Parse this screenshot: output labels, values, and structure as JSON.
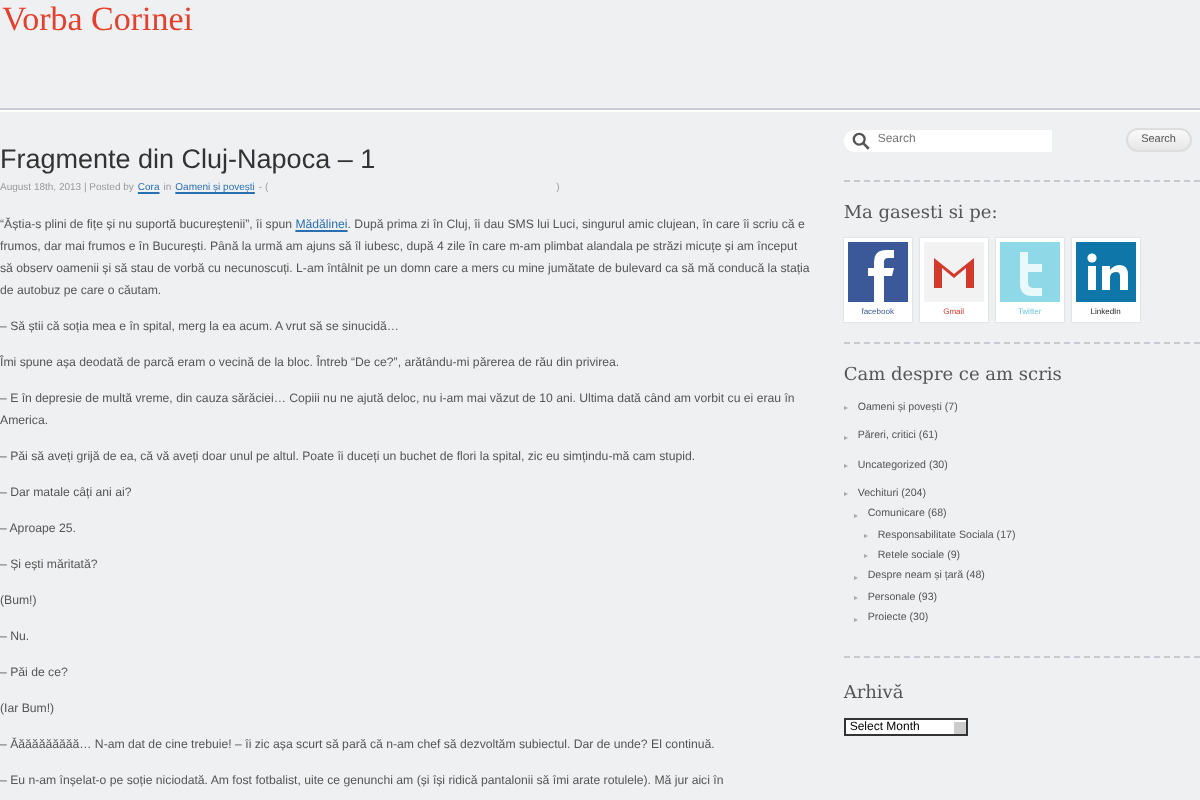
{
  "site_title": "Vorba Corinei",
  "post": {
    "title": "Fragmente din Cluj-Napoca – 1",
    "meta": {
      "date_posted": "August 18th, 2013 | Posted by",
      "author": "Cora",
      "in": "in",
      "category": "Oameni și povești",
      "open": "- (",
      "close": ")"
    },
    "paragraphs": [
      [
        {
          "text": "“Ăștia-s plini de fițe și nu suportă bucureștenii”, îi spun "
        },
        {
          "link": "Mădălinei"
        },
        {
          "text": ". După prima zi în Cluj, îi dau SMS lui Luci, singurul amic clujean, în care îi scriu că e frumos, dar mai frumos e în București. Până la urmă am ajuns să îl iubesc, după 4 zile în care m-am plimbat alandala pe străzi micuțe și am început să observ oamenii și să stau de vorbă cu necunoscuți. L-am întâlnit pe un domn care a mers cu mine jumătate de bulevard ca să mă conducă la stația de autobuz pe care o căutam."
        }
      ],
      [
        {
          "text": "– Să știi că soția mea e în spital, merg la ea acum. A vrut să se sinucidă…"
        }
      ],
      [
        {
          "text": "Îmi spune așa deodată de parcă eram o vecină de la bloc. Întreb  “De ce?”, arătându-mi părerea de rău din privirea."
        }
      ],
      [
        {
          "text": "– E în depresie de multă vreme, din cauza sărăciei… Copiii nu ne ajută deloc, nu i-am mai văzut de 10 ani. Ultima dată când am vorbit cu ei erau în America."
        }
      ],
      [
        {
          "text": "– Păi să aveți grijă de ea, că vă aveți doar unul pe altul. Poate îi duceți un buchet de flori la spital, zic eu simțindu-mă cam stupid."
        }
      ],
      [
        {
          "text": "– Dar matale câți ani ai?"
        }
      ],
      [
        {
          "text": "– Aproape 25."
        }
      ],
      [
        {
          "text": "– Și ești măritată?"
        }
      ],
      [
        {
          "text": "(Bum!)"
        }
      ],
      [
        {
          "text": "– Nu."
        }
      ],
      [
        {
          "text": "– Păi de ce?"
        }
      ],
      [
        {
          "text": "(Iar Bum!)"
        }
      ],
      [
        {
          "text": "– Ăăăăăăăăăă… N-am dat de cine trebuie! – îi zic așa scurt să pară că n-am chef să dezvoltăm subiectul. Dar de unde? El continuă."
        }
      ],
      [
        {
          "text": "– Eu n-am înșelat-o pe soție niciodată. Am fost fotbalist, uite ce genunchi am (și își ridică pantalonii să îmi arate rotulele). Mă jur aici în"
        }
      ]
    ]
  },
  "search": {
    "placeholder": "Search",
    "button": "Search"
  },
  "social": {
    "title": "Ma gasesti si pe:",
    "items": [
      {
        "kind": "facebook",
        "label": "facebook"
      },
      {
        "kind": "gmail",
        "label": "Gmail"
      },
      {
        "kind": "twitter",
        "label": "Twitter"
      },
      {
        "kind": "linkedin",
        "label": "LinkedIn"
      }
    ]
  },
  "categories": {
    "title": "Cam despre ce am scris",
    "items": [
      {
        "label": "Oameni și povești (7)"
      },
      {
        "label": "Păreri, critici (61)"
      },
      {
        "label": "Uncategorized (30)"
      },
      {
        "label": "Vechituri (204)",
        "children": [
          {
            "label": "Comunicare (68)",
            "children": [
              {
                "label": "Responsabilitate Sociala (17)"
              },
              {
                "label": "Retele sociale (9)"
              }
            ]
          },
          {
            "label": "Despre neam și țară (48)"
          },
          {
            "label": "Personale (93)"
          },
          {
            "label": "Proiecte (30)"
          }
        ]
      }
    ]
  },
  "archive": {
    "title": "Arhivă",
    "select": "Select Month"
  }
}
